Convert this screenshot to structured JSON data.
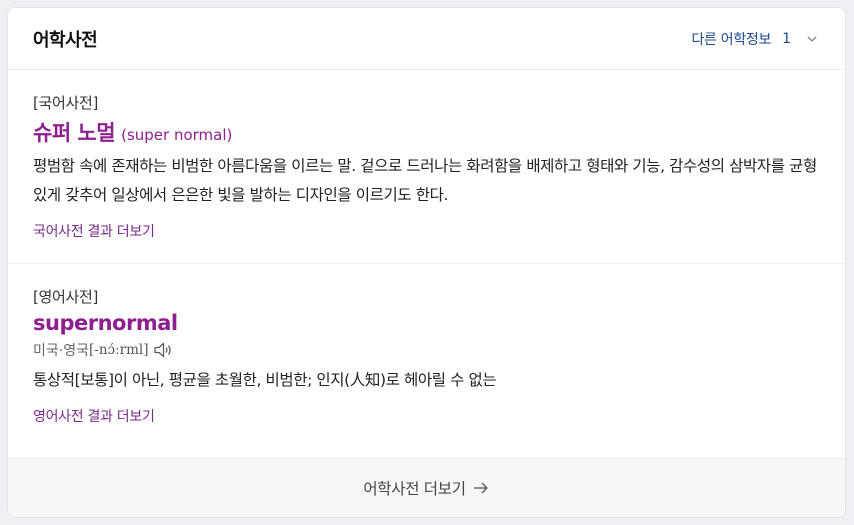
{
  "header": {
    "title": "어학사전",
    "other_info_label": "다른 어학정보",
    "other_info_count": "1"
  },
  "entries": [
    {
      "dictionary": "[국어사전]",
      "word": "슈퍼 노멀",
      "original": "(super normal)",
      "meaning": "평범함 속에 존재하는 비범한 아름다움을 이르는 말. 겉으로 드러나는 화려함을 배제하고 형태와 기능, 감수성의 삼박자를 균형 있게 갖추어 일상에서 은은한 빛을 발하는 디자인을 이르기도 한다.",
      "more_label": "국어사전 결과 더보기"
    },
    {
      "dictionary": "[영어사전]",
      "word": "supernormal",
      "pron_region": "미국·영국",
      "pron_ipa": "[-nɔ́ːrml]",
      "meaning": "통상적[보통]이 아닌, 평균을 초월한, 비범한; 인지(人知)로 헤아릴 수 없는",
      "more_label": "영어사전 결과 더보기"
    }
  ],
  "footer": {
    "label": "어학사전 더보기"
  },
  "colors": {
    "word": "#8e1f8f",
    "link": "#7a2a8a",
    "header_link": "#1f4a8e"
  }
}
